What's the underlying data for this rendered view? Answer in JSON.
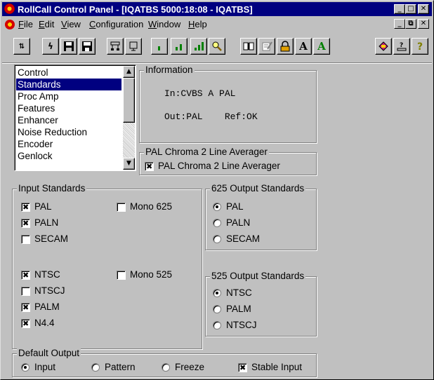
{
  "window": {
    "title": "RollCall Control Panel - [IQATBS 5000:18:08 - IQATBS]"
  },
  "menu": {
    "items": [
      {
        "label": "File",
        "u": "F",
        "rest": "ile"
      },
      {
        "label": "Edit",
        "u": "E",
        "rest": "dit"
      },
      {
        "label": "View",
        "u": "V",
        "rest": "iew"
      },
      {
        "label": "Configuration",
        "u": "C",
        "rest": "onfiguration"
      },
      {
        "label": "Window",
        "u": "W",
        "rest": "indow"
      },
      {
        "label": "Help",
        "u": "H",
        "rest": "elp"
      }
    ]
  },
  "toolbar": {
    "buttons": [
      {
        "icon": "connect-icon"
      },
      {
        "icon": "lightning-icon"
      },
      {
        "icon": "save-icon"
      },
      {
        "icon": "save-all-icon"
      },
      {
        "icon": "network-icon"
      },
      {
        "icon": "device-icon"
      },
      {
        "icon": "signal-low-icon"
      },
      {
        "icon": "signal-medium-icon"
      },
      {
        "icon": "signal-high-icon"
      },
      {
        "icon": "search-icon"
      },
      {
        "icon": "book-icon"
      },
      {
        "icon": "edit-form-icon"
      },
      {
        "icon": "lock-icon"
      },
      {
        "icon": "font-a-icon"
      },
      {
        "icon": "font-a-green-icon"
      },
      {
        "icon": "log-icon"
      },
      {
        "icon": "help-about-icon"
      },
      {
        "icon": "context-help-icon"
      }
    ],
    "font_a_label": "A"
  },
  "nav_list": {
    "items": [
      "Control",
      "Standards",
      "Proc Amp",
      "Features",
      "Enhancer",
      "Noise Reduction",
      "Encoder",
      "Genlock"
    ],
    "selected": "Standards"
  },
  "information": {
    "label": "Information",
    "line1": "In:CVBS A PAL",
    "line2": "Out:PAL    Ref:OK"
  },
  "pal_chroma": {
    "label": "PAL Chroma 2 Line Averager",
    "checkbox_label": "PAL Chroma 2 Line Averager",
    "checked": true
  },
  "input_standards": {
    "label": "Input Standards",
    "pal": {
      "label": "PAL",
      "checked": true
    },
    "paln": {
      "label": "PALN",
      "checked": true
    },
    "secam": {
      "label": "SECAM",
      "checked": false
    },
    "mono625": {
      "label": "Mono 625",
      "checked": false
    },
    "ntsc": {
      "label": "NTSC",
      "checked": true
    },
    "ntscj": {
      "label": "NTSCJ",
      "checked": false
    },
    "palm": {
      "label": "PALM",
      "checked": true
    },
    "n44": {
      "label": "N4.4",
      "checked": true
    },
    "mono525": {
      "label": "Mono 525",
      "checked": false
    }
  },
  "output625": {
    "label": "625 Output Standards",
    "options": [
      "PAL",
      "PALN",
      "SECAM"
    ],
    "selected": "PAL"
  },
  "output525": {
    "label": "525 Output Standards",
    "options": [
      "NTSC",
      "PALM",
      "NTSCJ"
    ],
    "selected": "NTSC"
  },
  "default_output": {
    "label": "Default Output",
    "options": [
      "Input",
      "Pattern",
      "Freeze"
    ],
    "selected": "Input",
    "stable_input": {
      "label": "Stable Input",
      "checked": true
    }
  },
  "colors": {
    "titlebar": "#000080",
    "face": "#c0c0c0",
    "selection": "#000080"
  }
}
